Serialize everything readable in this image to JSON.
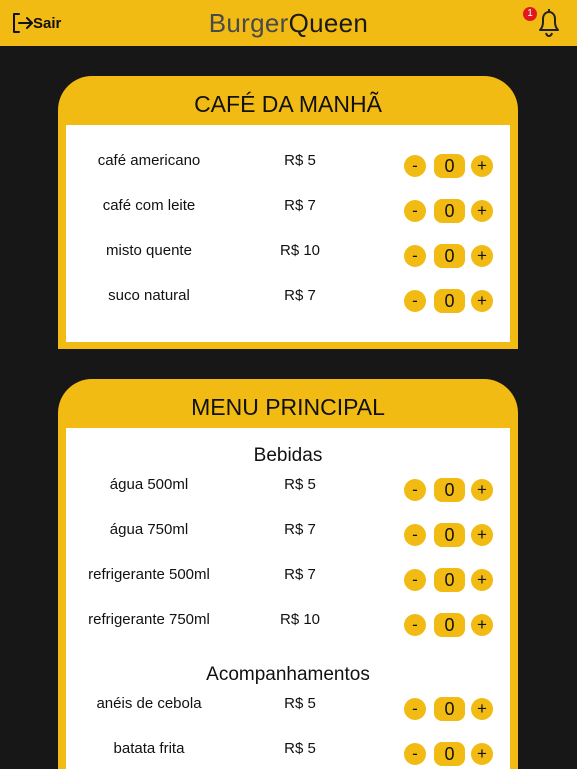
{
  "header": {
    "logout_label": "Sair",
    "logo_part1": "Burger",
    "logo_part2": "Queen",
    "notification_count": "1"
  },
  "colors": {
    "accent": "#f2bb14",
    "background": "#171717",
    "badge": "#e0191f"
  },
  "breakfast": {
    "title": "CAFÉ DA MANHÃ",
    "items": [
      {
        "name": "café americano",
        "price": "R$ 5",
        "qty": "0"
      },
      {
        "name": "café com leite",
        "price": "R$ 7",
        "qty": "0"
      },
      {
        "name": "misto quente",
        "price": "R$ 10",
        "qty": "0"
      },
      {
        "name": "suco natural",
        "price": "R$ 7",
        "qty": "0"
      }
    ]
  },
  "main_menu": {
    "title": "MENU PRINCIPAL",
    "drinks_title": "Bebidas",
    "drinks": [
      {
        "name": "água 500ml",
        "price": "R$ 5",
        "qty": "0"
      },
      {
        "name": "água 750ml",
        "price": "R$ 7",
        "qty": "0"
      },
      {
        "name": "refrigerante 500ml",
        "price": "R$ 7",
        "qty": "0"
      },
      {
        "name": "refrigerante 750ml",
        "price": "R$ 10",
        "qty": "0"
      }
    ],
    "sides_title": "Acompanhamentos",
    "sides": [
      {
        "name": "anéis de cebola",
        "price": "R$ 5",
        "qty": "0"
      },
      {
        "name": "batata frita",
        "price": "R$ 5",
        "qty": "0"
      }
    ]
  },
  "controls": {
    "minus_label": "-",
    "plus_label": "+"
  }
}
